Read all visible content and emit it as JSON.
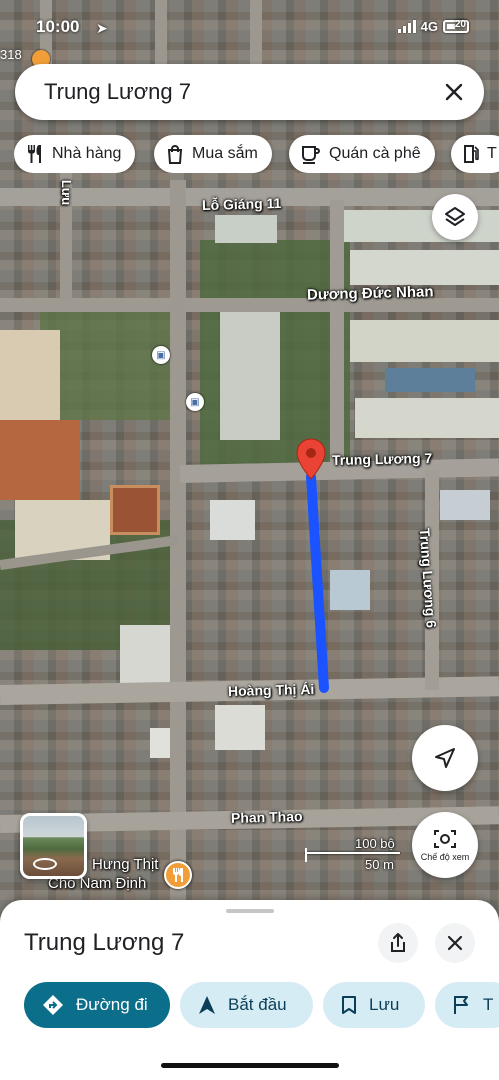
{
  "status_bar": {
    "time": "10:00",
    "network": "4G",
    "battery_label": "20"
  },
  "search": {
    "value": "Trung Lương 7"
  },
  "chips": [
    {
      "label": "Nhà hàng",
      "icon": "fork-knife-icon"
    },
    {
      "label": "Mua sắm",
      "icon": "shopping-bag-icon"
    },
    {
      "label": "Quán cà phê",
      "icon": "coffee-cup-icon"
    },
    {
      "label": "T",
      "icon": "gas-station-icon"
    }
  ],
  "map": {
    "corner_label": "318",
    "street_labels": {
      "lo_giang": "Lỗ Giáng 11",
      "duong_duc_nhan": "Dương Đức Nhan",
      "trung_luong_7": "Trung Lương 7",
      "trung_luong_6": "Trung Lương 6",
      "hoang_thi_ai": "Hoàng Thị Ái",
      "phan_thao": "Phan Thao",
      "left_vertical": "Lưu"
    },
    "poi": {
      "name_line1": "Hưng Thịt",
      "name_line2": "Chó Nam Định",
      "icon": "restaurant-icon"
    },
    "scale": {
      "feet": "100 bộ",
      "meters": "50 m"
    },
    "view_mode_label": "Chế độ xem",
    "route_color": "#1a53ff",
    "marker_color": "#ea4335"
  },
  "sheet": {
    "title": "Trung Lương 7",
    "actions": [
      {
        "label": "Đường đi",
        "icon": "directions-icon",
        "style": "primary"
      },
      {
        "label": "Bắt đầu",
        "icon": "navigation-arrow-icon",
        "style": "secondary"
      },
      {
        "label": "Lưu",
        "icon": "bookmark-icon",
        "style": "secondary"
      },
      {
        "label": "T",
        "icon": "flag-icon",
        "style": "secondary"
      }
    ]
  },
  "colors": {
    "primary_action": "#0b6e8a",
    "secondary_action": "#d6ecf4"
  }
}
